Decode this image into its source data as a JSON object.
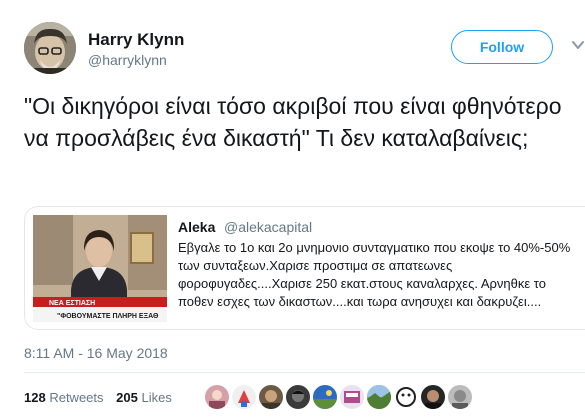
{
  "author": {
    "name": "Harry Klynn",
    "handle": "@harryklynn"
  },
  "follow_label": "Follow",
  "tweet_text": "\"Οι δικηγόροι είναι τόσο ακριβοί που είναι φθηνότερο να προσλάβεις ένα δικαστή\" Τι δεν καταλαβαίνεις;",
  "quoted": {
    "name": "Aleka",
    "handle": "@alekacapital",
    "text": "Εβγαλε το 1ο και 2ο μνημονιο συνταγματικο που εκοψε το 40%-50% των συνταξεων.Χαρισε προστιμα σε απατεωνες φοροφυγαδες....Χαρισε 250 εκατ.στους καναλαρχες. Αρνηθκε το ποθεν εσχες των δικαστων....και τωρα ανησυχει και δακρυζει....",
    "media": {
      "ticker": "ΝΕΑ ΕΣΤΙΑΣΗ",
      "caption": "\"ΦΟΒΟΥΜΑΣΤΕ ΠΛΗΡΗ ΕΞΑΘ"
    }
  },
  "timestamp": "8:11 AM - 16 May 2018",
  "stats": {
    "retweets_count": "128",
    "retweets_label": "Retweets",
    "likes_count": "205",
    "likes_label": "Likes"
  },
  "likers_count_shown": 10,
  "colors": {
    "accent": "#1da1f2",
    "secondary_text": "#657786",
    "border": "#e1e8ed"
  }
}
